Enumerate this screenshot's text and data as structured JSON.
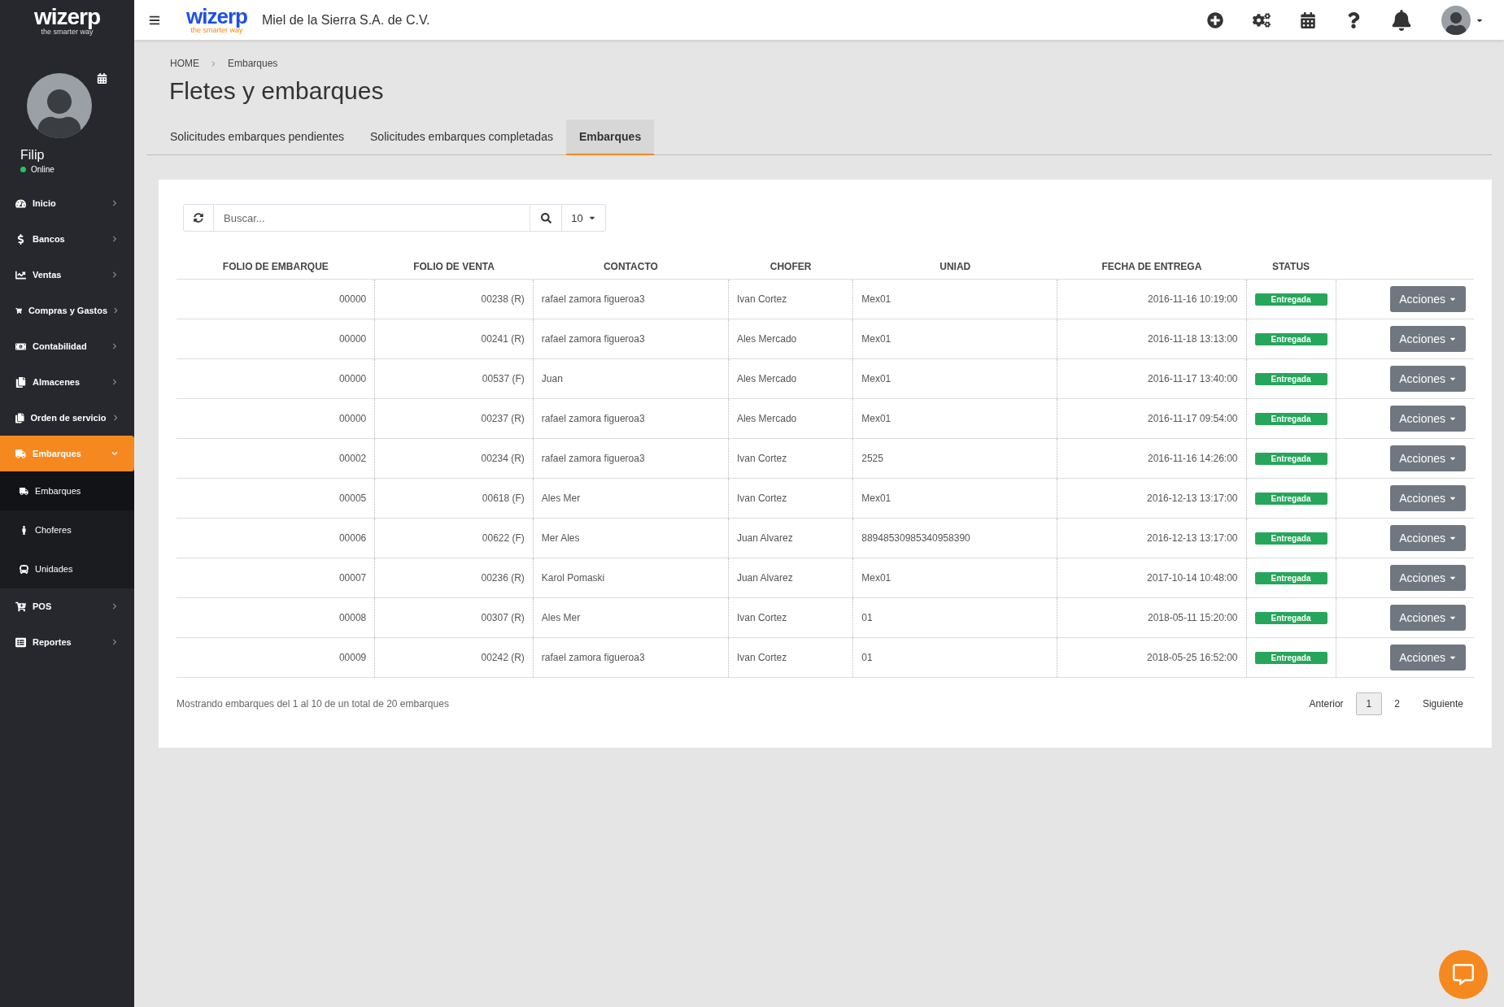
{
  "sidebar": {
    "logo": {
      "name": "wizerp",
      "tagline": "the smarter way"
    },
    "user": {
      "name": "Filip",
      "status": "Online"
    },
    "items": [
      {
        "label": "Inicio",
        "expanded": false
      },
      {
        "label": "Bancos",
        "expanded": false
      },
      {
        "label": "Ventas",
        "expanded": false
      },
      {
        "label": "Compras y Gastos",
        "expanded": false
      },
      {
        "label": "Contabilidad",
        "expanded": false
      },
      {
        "label": "Almacenes",
        "expanded": false
      },
      {
        "label": "Orden de servicio",
        "expanded": false
      },
      {
        "label": "Embarques",
        "expanded": true,
        "children": [
          {
            "label": "Embarques",
            "selected": true
          },
          {
            "label": "Choferes",
            "selected": false
          },
          {
            "label": "Unidades",
            "selected": false
          }
        ]
      },
      {
        "label": "POS",
        "expanded": false
      },
      {
        "label": "Reportes",
        "expanded": false
      }
    ]
  },
  "topbar": {
    "logo": {
      "name": "wizerp",
      "tagline": "the smarter way"
    },
    "company": "Miel de la Sierra S.A. de C.V."
  },
  "breadcrumb": [
    "HOME",
    "Embarques"
  ],
  "title": "Fletes y embarques",
  "tabs": [
    {
      "label": "Solicitudes embarques pendientes",
      "selected": false
    },
    {
      "label": "Solicitudes embarques completadas",
      "selected": false
    },
    {
      "label": "Embarques",
      "selected": true
    }
  ],
  "search": {
    "placeholder": "Buscar...",
    "page_size": "10"
  },
  "table": {
    "columns": [
      "FOLIO DE EMBARQUE",
      "FOLIO DE VENTA",
      "CONTACTO",
      "CHOFER",
      "UNIAD",
      "FECHA DE ENTREGA",
      "STATUS"
    ],
    "rows": [
      {
        "folio": "00000",
        "venta": "00238 (R)",
        "contacto": "rafael zamora figueroa3",
        "chofer": "Ivan Cortez",
        "unidad": "Mex01",
        "fecha": "2016-11-16 10:19:00",
        "status": "Entregada",
        "action": "Acciones"
      },
      {
        "folio": "00000",
        "venta": "00241 (R)",
        "contacto": "rafael zamora figueroa3",
        "chofer": "Ales Mercado",
        "unidad": "Mex01",
        "fecha": "2016-11-18 13:13:00",
        "status": "Entregada",
        "action": "Acciones"
      },
      {
        "folio": "00000",
        "venta": "00537 (F)",
        "contacto": "Juan",
        "chofer": "Ales Mercado",
        "unidad": "Mex01",
        "fecha": "2016-11-17 13:40:00",
        "status": "Entregada",
        "action": "Acciones"
      },
      {
        "folio": "00000",
        "venta": "00237 (R)",
        "contacto": "rafael zamora figueroa3",
        "chofer": "Ales Mercado",
        "unidad": "Mex01",
        "fecha": "2016-11-17 09:54:00",
        "status": "Entregada",
        "action": "Acciones"
      },
      {
        "folio": "00002",
        "venta": "00234 (R)",
        "contacto": "rafael zamora figueroa3",
        "chofer": "Ivan Cortez",
        "unidad": "2525",
        "fecha": "2016-11-16 14:26:00",
        "status": "Entregada",
        "action": "Acciones"
      },
      {
        "folio": "00005",
        "venta": "00618 (F)",
        "contacto": "Ales Mer",
        "chofer": "Ivan Cortez",
        "unidad": "Mex01",
        "fecha": "2016-12-13 13:17:00",
        "status": "Entregada",
        "action": "Acciones"
      },
      {
        "folio": "00006",
        "venta": "00622 (F)",
        "contacto": "Mer Ales",
        "chofer": "Juan Alvarez",
        "unidad": "88948530985340958390",
        "fecha": "2016-12-13 13:17:00",
        "status": "Entregada",
        "action": "Acciones"
      },
      {
        "folio": "00007",
        "venta": "00236 (R)",
        "contacto": "Karol Pomaski",
        "chofer": "Juan Alvarez",
        "unidad": "Mex01",
        "fecha": "2017-10-14 10:48:00",
        "status": "Entregada",
        "action": "Acciones"
      },
      {
        "folio": "00008",
        "venta": "00307 (R)",
        "contacto": "Ales Mer",
        "chofer": "Ivan Cortez",
        "unidad": "01",
        "fecha": "2018-05-11 15:20:00",
        "status": "Entregada",
        "action": "Acciones"
      },
      {
        "folio": "00009",
        "venta": "00242 (R)",
        "contacto": "rafael zamora figueroa3",
        "chofer": "Ivan Cortez",
        "unidad": "01",
        "fecha": "2018-05-25 16:52:00",
        "status": "Entregada",
        "action": "Acciones"
      }
    ]
  },
  "footer": {
    "summary": "Mostrando embarques del 1 al 10 de un total de 20 embarques",
    "previous": "Anterior",
    "pages": [
      {
        "label": "1",
        "selected": true
      },
      {
        "label": "2",
        "selected": false
      }
    ],
    "next": "Siguiente"
  }
}
